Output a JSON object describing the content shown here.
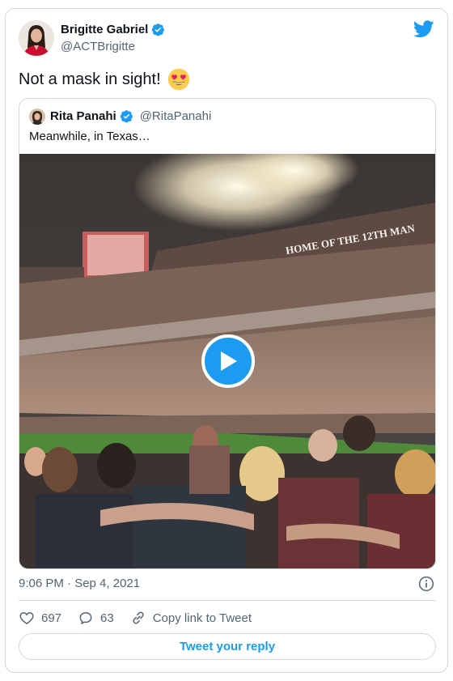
{
  "author": {
    "name": "Brigitte Gabriel",
    "handle": "@ACTBrigitte",
    "verified": true
  },
  "tweet": {
    "text": "Not a mask in sight!",
    "emoji": "smiling-face-with-heart-eyes"
  },
  "quoted_tweet": {
    "author": {
      "name": "Rita Panahi",
      "handle": "@RitaPanahi",
      "verified": true
    },
    "text": "Meanwhile, in Texas…",
    "media": {
      "type": "video",
      "stadium_banner": "HOME OF THE 12TH MAN"
    }
  },
  "timestamp": "9:06 PM · Sep 4, 2021",
  "actions": {
    "likes": "697",
    "replies": "63",
    "copy_link": "Copy link to Tweet"
  },
  "reply_button": "Tweet your reply",
  "colors": {
    "accent": "#1d9bf0",
    "text": "#0f1419",
    "secondary": "#536471",
    "border": "#cfd9de"
  },
  "icons": [
    "verified-badge-icon",
    "twitter-bird-icon",
    "play-icon",
    "info-icon",
    "heart-icon",
    "reply-bubble-icon",
    "link-icon"
  ]
}
